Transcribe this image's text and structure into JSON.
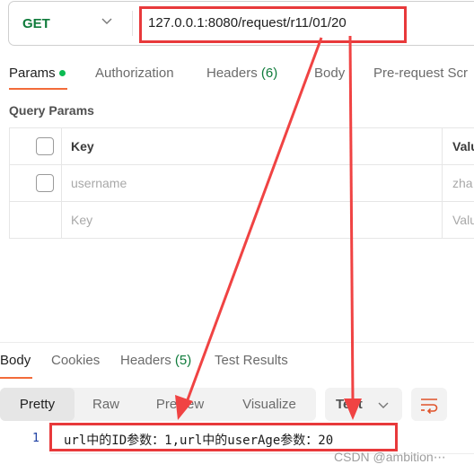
{
  "request": {
    "method": "GET",
    "url": "127.0.0.1:8080/request/r11/01/20"
  },
  "request_tabs": [
    {
      "label": "Params",
      "active": true,
      "has_dot": true
    },
    {
      "label": "Authorization"
    },
    {
      "label": "Headers",
      "count": "(6)"
    },
    {
      "label": "Body"
    },
    {
      "label": "Pre-request Scr"
    }
  ],
  "query_params": {
    "title": "Query Params",
    "headers": {
      "key": "Key",
      "value": "Valu"
    },
    "rows": [
      {
        "key": "username",
        "value": "zha"
      },
      {
        "key_placeholder": "Key",
        "value_placeholder": "Valu"
      }
    ]
  },
  "response_tabs": [
    {
      "label": "Body",
      "active": true
    },
    {
      "label": "Cookies"
    },
    {
      "label": "Headers",
      "count": "(5)"
    },
    {
      "label": "Test Results"
    }
  ],
  "response_view": {
    "modes": [
      "Pretty",
      "Raw",
      "Preview",
      "Visualize"
    ],
    "active_mode": "Pretty",
    "format": "Text",
    "wrap_icon": "wrap-lines-icon"
  },
  "response_body": {
    "lines": [
      {
        "number": "1",
        "text": "url中的ID参数：1,url中的userAge参数：20"
      }
    ]
  },
  "colors": {
    "accent": "#f26b3a",
    "method_get": "#0f7b3b",
    "annotation_red": "#e8393b"
  },
  "watermark": "CSDN @ambition⋯"
}
